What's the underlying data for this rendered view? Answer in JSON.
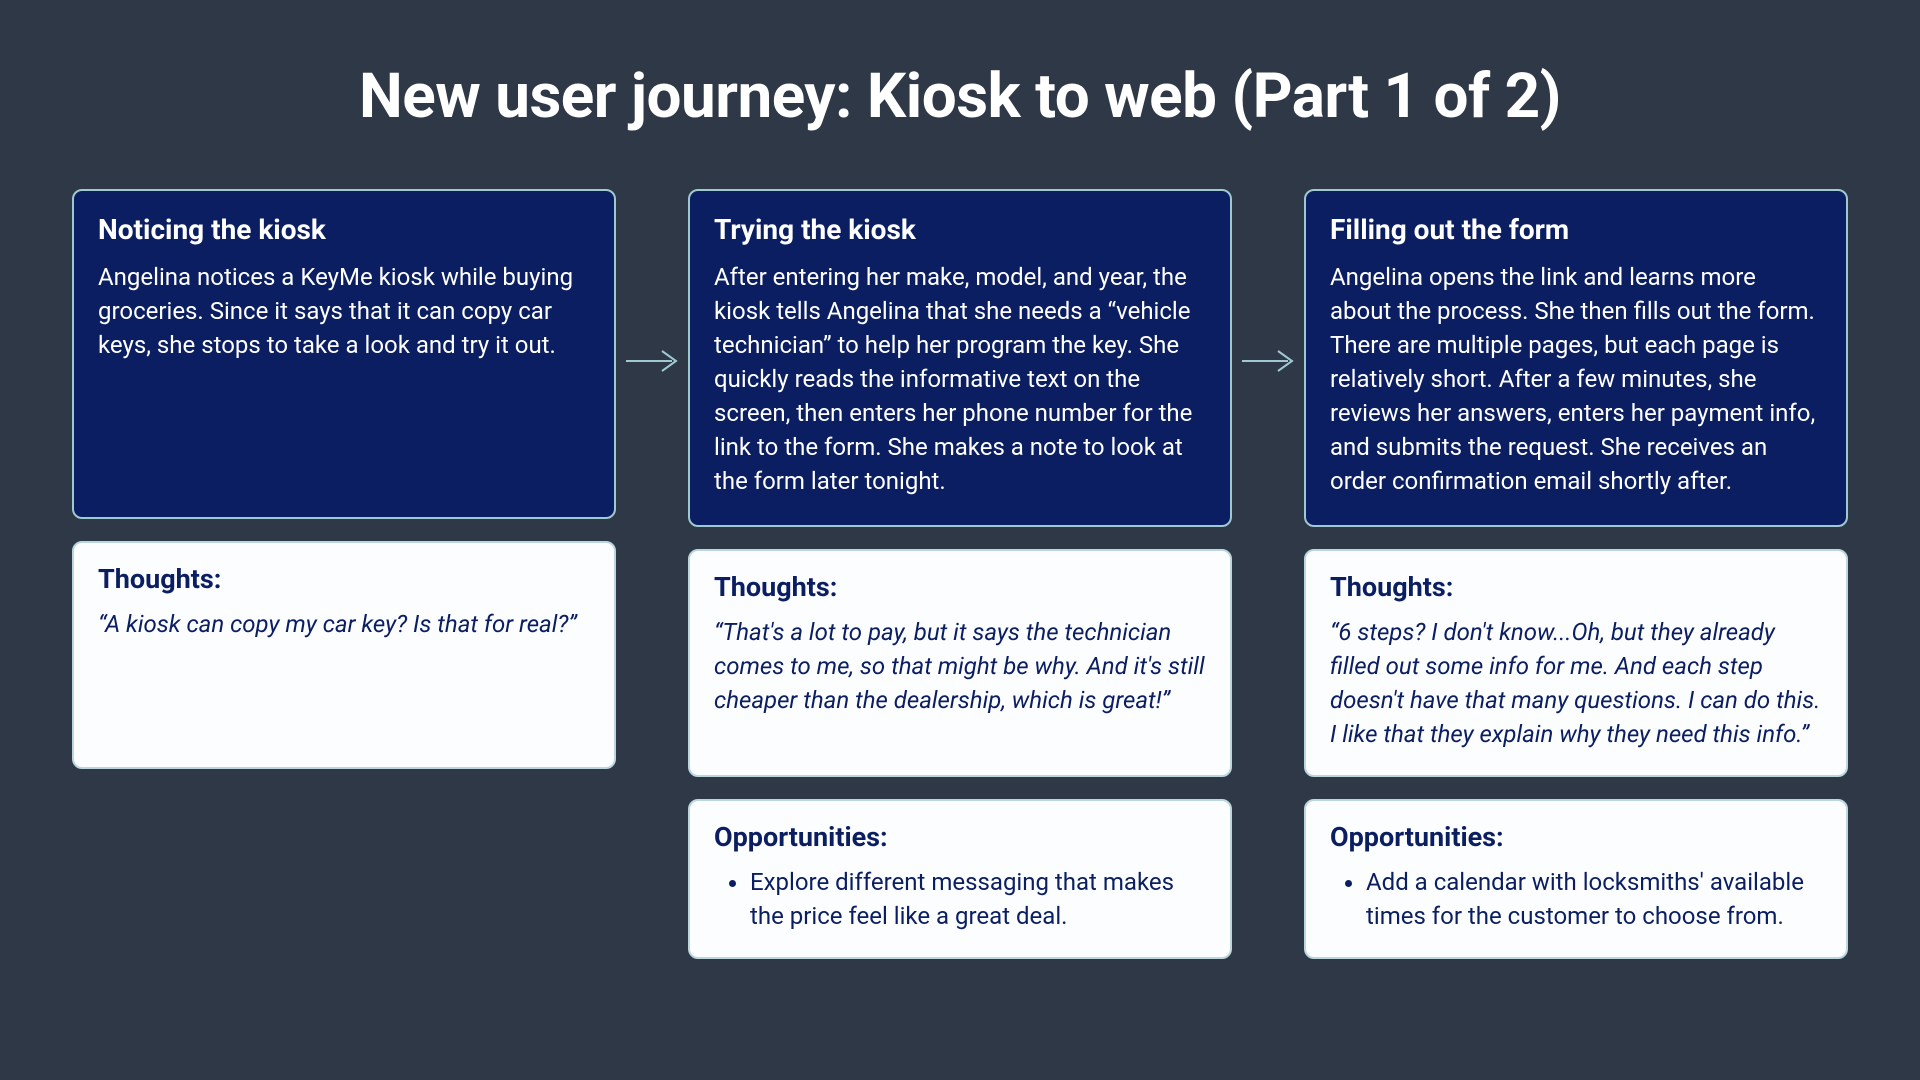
{
  "title": "New user journey: Kiosk to web (Part 1 of 2)",
  "thoughts_label": "Thoughts:",
  "opps_label": "Opportunities:",
  "steps": [
    {
      "title": "Noticing the kiosk",
      "body": "Angelina notices a KeyMe kiosk while buying groceries. Since it says that it can copy car keys, she stops to take a look and try it out.",
      "thoughts": "“A kiosk can copy my car key? Is that for real?”",
      "opportunity": ""
    },
    {
      "title": "Trying the kiosk",
      "body": "After entering her make, model, and year, the kiosk tells Angelina that she needs a “vehicle technician” to help her program the key. She quickly reads the informative text on the screen, then enters her phone number for the link to the form. She makes a note to look at the form later tonight.",
      "thoughts": "“That's a lot to pay, but it says the technician comes to me, so that might be why. And it's still cheaper than the dealership, which is great!”",
      "opportunity": "Explore different messaging that makes the price feel like a great deal."
    },
    {
      "title": "Filling out the form",
      "body": "Angelina opens the link and learns more about the process. She then fills out the form. There are multiple pages, but each page is relatively short. After a few minutes, she reviews her answers, enters her payment info, and submits the request. She receives an order confirmation email shortly after.",
      "thoughts": "“6 steps? I don't know...Oh, but they already filled out some info for me. And each step doesn't have that many questions. I can do this. I like that they explain why they need this info.”",
      "opportunity": "Add a calendar with locksmiths' available times for the customer to choose from."
    }
  ]
}
